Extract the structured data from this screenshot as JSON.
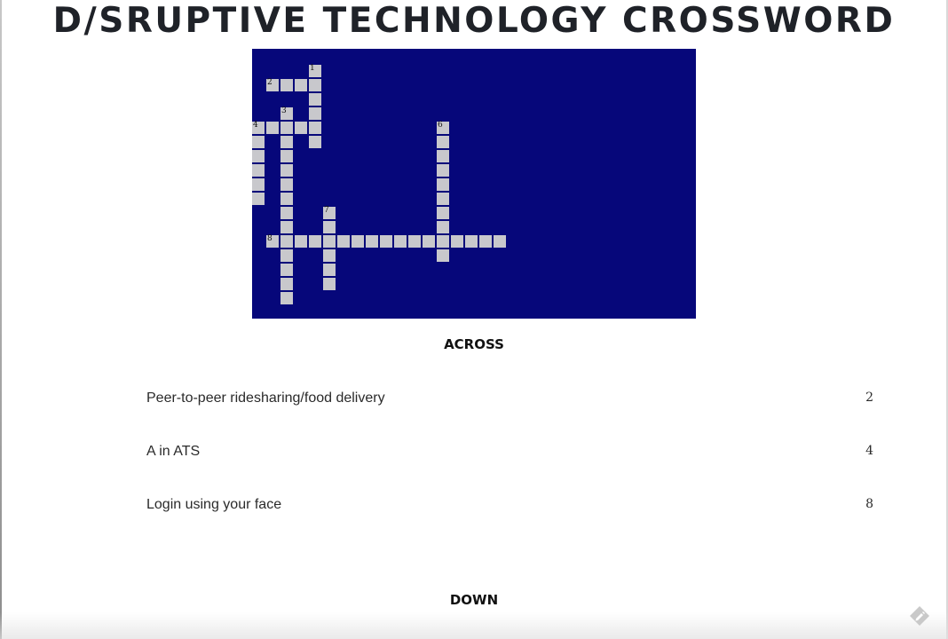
{
  "page": {
    "title": "D/SRUPTIVE TECHNOLOGY CROSSWORD"
  },
  "crossword": {
    "board_color": "#06077a",
    "cell_color": "#c8c8cc",
    "cols": 31,
    "rows": 19,
    "entries": [
      {
        "number": "1",
        "direction": "down",
        "row": 1,
        "col": 4,
        "length": 6
      },
      {
        "number": "2",
        "direction": "across",
        "row": 2,
        "col": 1,
        "length": 4
      },
      {
        "number": "3",
        "direction": "down",
        "row": 4,
        "col": 2,
        "length": 14
      },
      {
        "number": "4",
        "direction": "across",
        "row": 5,
        "col": 0,
        "length": 5
      },
      {
        "number": "4",
        "direction": "down",
        "row": 5,
        "col": 0,
        "length": 6
      },
      {
        "number": "6",
        "direction": "down",
        "row": 5,
        "col": 13,
        "length": 10
      },
      {
        "number": "7",
        "direction": "down",
        "row": 11,
        "col": 5,
        "length": 6
      },
      {
        "number": "8",
        "direction": "across",
        "row": 13,
        "col": 1,
        "length": 17
      }
    ],
    "numbers": [
      {
        "label": "1",
        "row": 1,
        "col": 4
      },
      {
        "label": "2",
        "row": 2,
        "col": 1
      },
      {
        "label": "3",
        "row": 4,
        "col": 2
      },
      {
        "label": "4",
        "row": 5,
        "col": 0
      },
      {
        "label": "6",
        "row": 5,
        "col": 13
      },
      {
        "label": "7",
        "row": 11,
        "col": 5
      },
      {
        "label": "8",
        "row": 13,
        "col": 1
      }
    ]
  },
  "across": {
    "heading": "ACROSS",
    "clues": [
      {
        "text": "Peer-to-peer ridesharing/food delivery",
        "number": "2"
      },
      {
        "text": "A in ATS",
        "number": "4"
      },
      {
        "text": "Login using your face",
        "number": "8"
      }
    ]
  },
  "down": {
    "heading": "DOWN"
  },
  "icons": {
    "corner": "pencil-badge-icon"
  }
}
